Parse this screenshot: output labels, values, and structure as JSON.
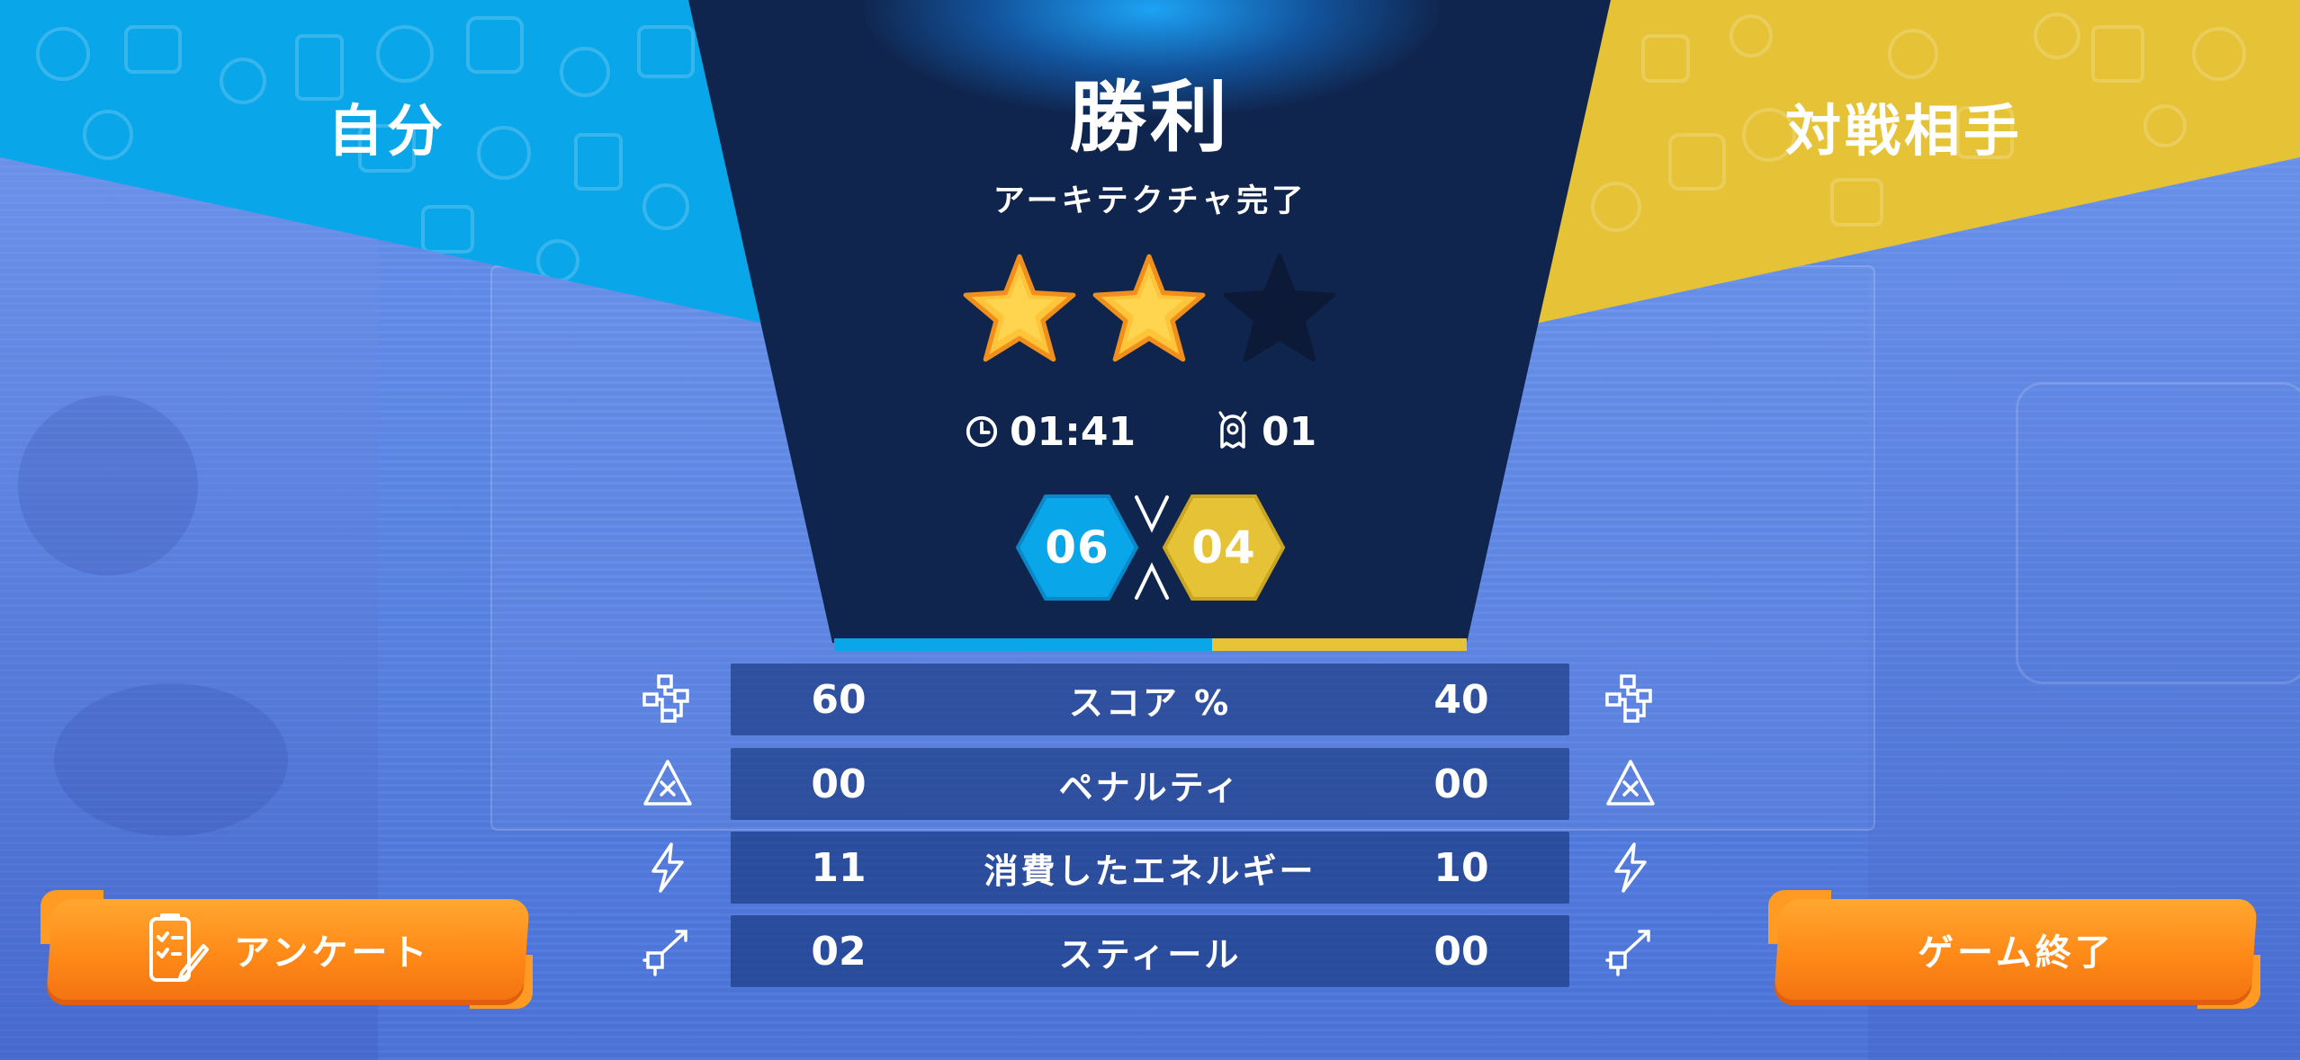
{
  "players": {
    "self_label": "自分",
    "opponent_label": "対戦相手"
  },
  "result": {
    "title": "勝利",
    "subtitle": "アーキテクチャ完了",
    "stars_earned": 2,
    "stars_total": 3
  },
  "stats": {
    "time": "01:41",
    "monsters": "01"
  },
  "score": {
    "self": "06",
    "opponent": "04",
    "self_share": 0.6
  },
  "table": {
    "rows": [
      {
        "label": "スコア %",
        "self": "60",
        "opponent": "40",
        "icon": "architecture-icon"
      },
      {
        "label": "ペナルティ",
        "self": "00",
        "opponent": "00",
        "icon": "penalty-warning-icon"
      },
      {
        "label": "消費したエネルギー",
        "self": "11",
        "opponent": "10",
        "icon": "energy-bolt-icon"
      },
      {
        "label": "スティール",
        "self": "02",
        "opponent": "00",
        "icon": "steal-icon"
      }
    ]
  },
  "buttons": {
    "survey": "アンケート",
    "end_game": "ゲーム終了"
  },
  "colors": {
    "self": "#0aa6ea",
    "opponent": "#e6c236",
    "panel": "#10254d",
    "button": "#ff8a18",
    "star_filled": "#ffc53a",
    "star_empty": "#0c1a38"
  }
}
